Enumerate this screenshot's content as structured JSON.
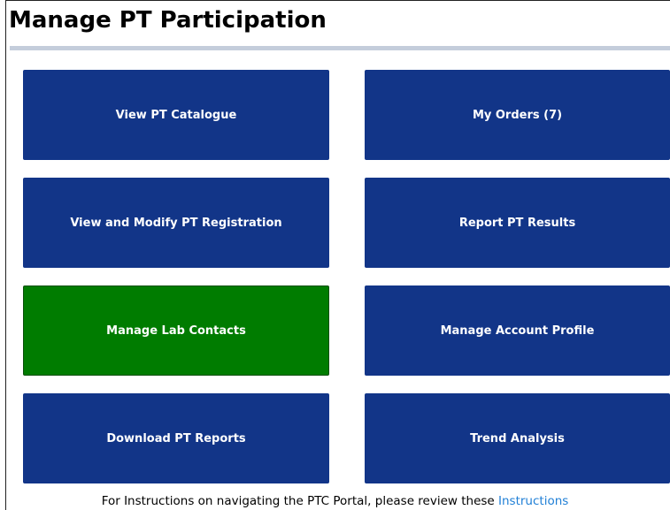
{
  "page": {
    "title": "Manage PT Participation"
  },
  "tiles": {
    "view_catalogue": "View PT Catalogue",
    "my_orders": "My Orders (7)",
    "view_modify_registration": "View and Modify PT Registration",
    "report_results": "Report PT Results",
    "manage_lab_contacts": "Manage Lab Contacts",
    "manage_account_profile": "Manage Account Profile",
    "download_reports": "Download PT Reports",
    "trend_analysis": "Trend Analysis"
  },
  "footer": {
    "text": "For Instructions on navigating the PTC Portal, please review these",
    "link_label": "Instructions"
  },
  "colors": {
    "tile_blue": "#123588",
    "tile_green_selected": "#007c00",
    "link": "#1f7fd6",
    "divider": "#c4cddb"
  }
}
